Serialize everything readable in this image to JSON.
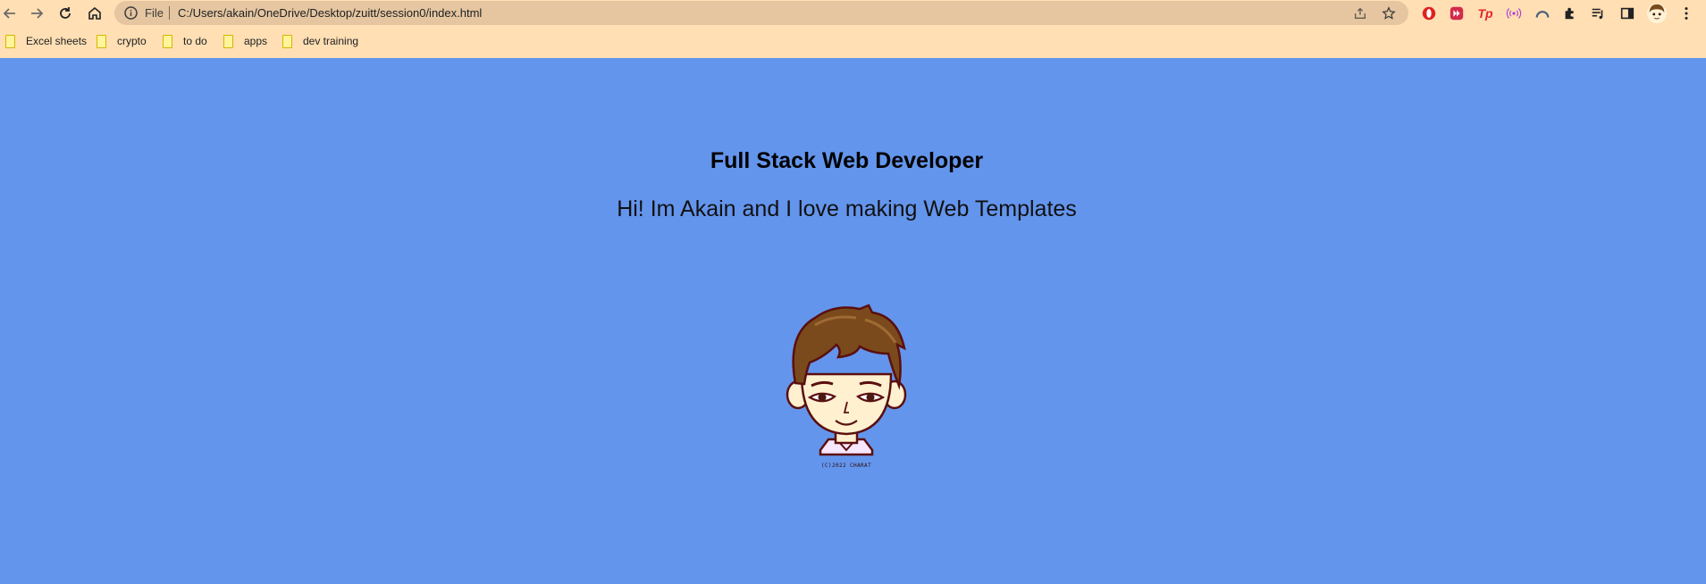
{
  "browser": {
    "omnibox": {
      "scheme_label": "File",
      "url": "C:/Users/akain/OneDrive/Desktop/zuitt/session0/index.html"
    },
    "icons": [
      "back-icon",
      "forward-icon",
      "reload-icon",
      "home-icon",
      "info-icon",
      "share-icon",
      "star-icon",
      "extensions-icon",
      "reading-list-icon",
      "side-panel-icon",
      "profile-avatar",
      "menu-icon"
    ],
    "extensions": [
      "opera-ext-icon",
      "media-ext-icon",
      "tp-ext-icon",
      "cast-ext-icon",
      "arc-ext-icon"
    ],
    "tp_label": "Tp",
    "bookmarks": [
      "Excel sheets",
      "crypto",
      "to do",
      "apps",
      "dev training"
    ]
  },
  "page": {
    "title": "Full Stack Web Developer",
    "subtitle": "Hi! Im Akain and I love making Web Templates",
    "avatar_caption": "(C)2022 CHARAT",
    "background": "#6495ed"
  }
}
